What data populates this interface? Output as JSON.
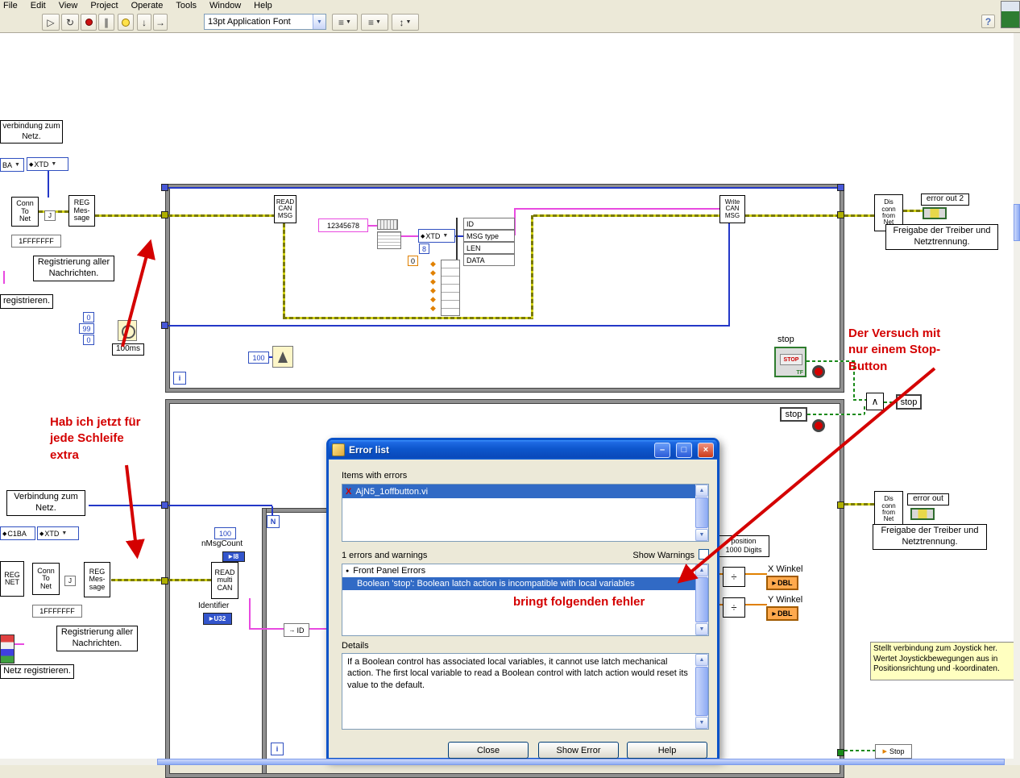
{
  "icons": {
    "dropdown": "▼",
    "diamond": "◆",
    "diamond_col": "◆◆◆◆◆◆",
    "run": "▷",
    "run_cont": "↻",
    "pause": "∥",
    "step_a": "↓",
    "step_b": "→",
    "align": "≡",
    "reorder": "↕",
    "bullet": "●",
    "cross": "X",
    "divide": "÷",
    "gate": "∧",
    "win_min": "–",
    "win_max": "□",
    "win_close": "×",
    "help": "?",
    "arrow": "▶",
    "up": "▲",
    "down": "▼"
  },
  "menu": {
    "items": [
      "File",
      "Edit",
      "View",
      "Project",
      "Operate",
      "Tools",
      "Window",
      "Help"
    ]
  },
  "toolbar": {
    "font": "13pt Application Font"
  },
  "diagram": {
    "labels": {
      "net_top": "verbindung zum Netz.",
      "reg_all_1": "Registrierung aller Nachrichten.",
      "registrieren": "registrieren.",
      "net_bottom": "Verbindung zum Netz.",
      "reg_all_2": "Registrierung aller Nachrichten.",
      "netz_registrieren": "Netz registrieren.",
      "freigabe_1": "Freigabe der Treiber und Netztrennung.",
      "freigabe_2": "Freigabe der Treiber und Netztrennung.",
      "joystick_note": "Stellt verbindung zum Joystick her. Wertet Joystickbewegungen aus in Positionsrichtung und -koordinaten.",
      "position_digits": "position\n1000 Digits",
      "x_winkel": "X Winkel",
      "y_winkel": "Y Winkel",
      "stop_caption": "stop",
      "identifier": "Identifier",
      "nmsgcount": "nMsgCount",
      "wait_ms": "100ms"
    },
    "annotations": {
      "one_stop": "Der Versuch mit\nnur einem Stop-\nButton",
      "each_loop": "Hab ich jetzt für\njede Schleife\nextra",
      "error_note": "bringt folgenden fehler"
    },
    "nodes": {
      "conn_to_net": "Conn\nTo\nNet",
      "reg_message": "REG\nMes-\nsage",
      "reg_net": "REG\nNET",
      "read_can": "READ\nCAN\nMSG",
      "write_can": "Write\nCAN\nMSG",
      "read_multi": "READ\nmulti\nCAN",
      "dis_conn": "Dis\nconn\nfrom\nNet",
      "error_out_2": "error out 2",
      "error_out": "error out",
      "stop_btn": "STOP",
      "tf": "TF",
      "stop_local": "stop",
      "stop_indicator": "stop",
      "stop_bottom": "Stop"
    },
    "consts": {
      "ba": "BA",
      "xtd": "XTD",
      "c1ba": "C1BA",
      "hex1": "1FFFFFFF",
      "hex2": "1FFFFFFF",
      "str_num": "12345678",
      "zero_a": "0",
      "ninetynine": "99",
      "zero_b": "0",
      "eight": "8",
      "zero_c": "0",
      "hundred_wait": "100",
      "hundred_count": "100",
      "i8": "I8",
      "u32": "U32",
      "n": "N",
      "i": "i",
      "id_small": "ID"
    },
    "cluster": [
      "ID",
      "MSG type",
      "LEN",
      "DATA"
    ],
    "dbl": "DBL"
  },
  "dialog": {
    "title": "Error list",
    "items_with_errors": "Items with errors",
    "error_file": "AjN5_1offbutton.vi",
    "count": "1 errors and warnings",
    "show_warnings": "Show Warnings",
    "front_panel_errors": "Front Panel Errors",
    "error_row": "Boolean 'stop': Boolean latch action is incompatible with local variables",
    "details_label": "Details",
    "details_text": "If a Boolean control has associated local variables, it cannot use latch mechanical action. The first local variable to read a Boolean control with latch action would reset its value to the default.",
    "buttons": {
      "close": "Close",
      "show_error": "Show Error",
      "help": "Help"
    }
  }
}
